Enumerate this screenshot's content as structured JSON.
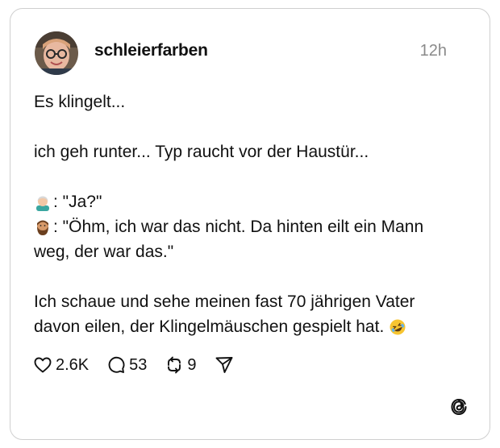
{
  "post": {
    "username": "schleierfarben",
    "timestamp": "12h",
    "lines": [
      "Es klingelt...",
      "ich geh runter... Typ raucht vor der Haustür...",
      ": \"Ja?\"",
      ": \"Öhm, ich war das nicht. Da hinten eilt ein Mann",
      "weg, der war das.\"",
      "Ich schaue und sehe meinen fast 70 jährigen Vater",
      "davon eilen, der Klingelmäuschen gespielt hat."
    ],
    "emoji_icons": [
      "man-white-hair-emoji-icon",
      "bearded-man-emoji-icon",
      "rolling-laughing-emoji-icon"
    ]
  },
  "actions": {
    "likes": "2.6K",
    "replies": "53",
    "reposts": "9"
  },
  "colors": {
    "text": "#111111",
    "muted": "#8a8a8a",
    "border": "#cfcfcf"
  },
  "icons": [
    "heart-icon",
    "comment-icon",
    "repost-icon",
    "share-icon",
    "threads-logo-icon"
  ]
}
